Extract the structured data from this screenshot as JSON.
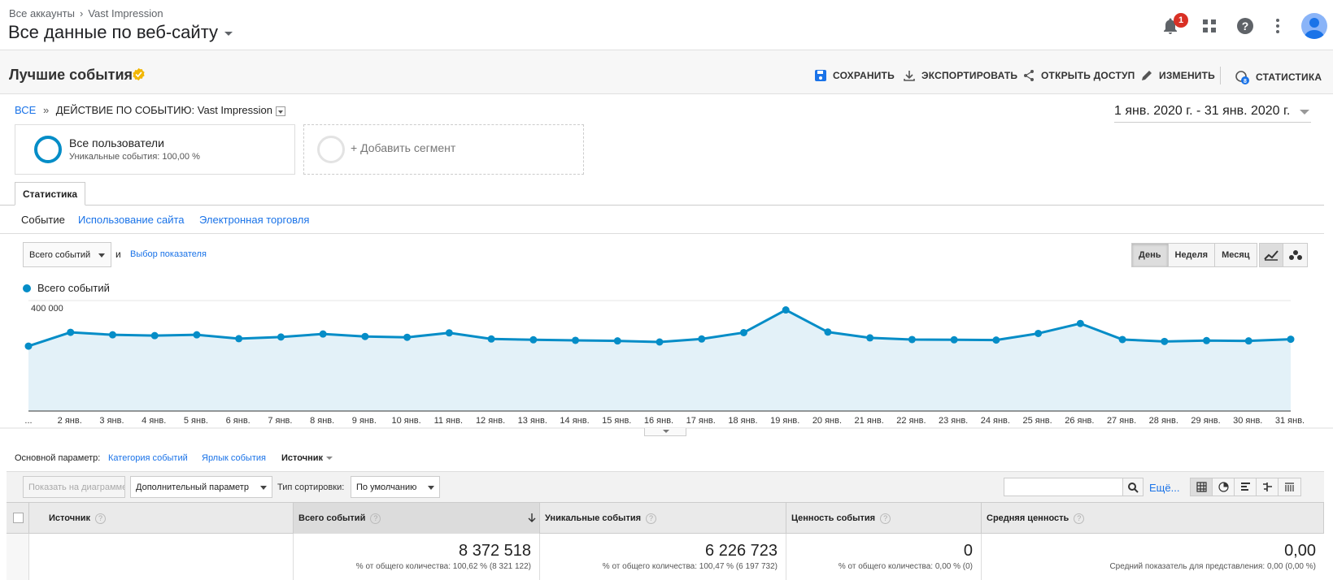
{
  "header": {
    "breadcrumb_root": "Все аккаунты",
    "breadcrumb_account": "Vast Impression",
    "view_title": "Все данные по веб-сайту",
    "notification_count": "1"
  },
  "report": {
    "title": "Лучшие события",
    "actions": {
      "save": "СОХРАНИТЬ",
      "export": "ЭКСПОРТИРОВАТЬ",
      "share": "ОТКРЫТЬ ДОСТУП",
      "edit": "ИЗМЕНИТЬ",
      "insights": "СТАТИСТИКА"
    },
    "insights_badge": "8",
    "breadcrumb_all": "ВСЕ",
    "breadcrumb_sep": "»",
    "breadcrumb_current": "ДЕЙСТВИЕ ПО СОБЫТИЮ: Vast Impression",
    "date_range": "1 янв. 2020 г. - 31 янв. 2020 г."
  },
  "segments": {
    "active_name": "Все пользователи",
    "active_sub": "Уникальные события: 100,00 %",
    "add_label": "+ Добавить сегмент"
  },
  "tabs": {
    "main": "Статистика",
    "sub": [
      "Событие",
      "Использование сайта",
      "Электронная торговля"
    ]
  },
  "chart_controls": {
    "metric": "Всего событий",
    "and": "и",
    "metric_pick": "Выбор показателя",
    "periods": [
      "День",
      "Неделя",
      "Месяц"
    ],
    "active_period": "День"
  },
  "chart_data": {
    "type": "area",
    "series": [
      {
        "name": "Всего событий",
        "values": [
          235000,
          285000,
          276000,
          273000,
          276000,
          262000,
          268000,
          279000,
          270000,
          267000,
          283000,
          261000,
          258000,
          256000,
          254000,
          250000,
          261000,
          284000,
          366000,
          286000,
          265000,
          259000,
          258000,
          257000,
          281000,
          317000,
          259000,
          252000,
          255000,
          254000,
          260000
        ]
      }
    ],
    "x": [
      "...",
      "2 янв.",
      "3 янв.",
      "4 янв.",
      "5 янв.",
      "6 янв.",
      "7 янв.",
      "8 янв.",
      "9 янв.",
      "10 янв.",
      "11 янв.",
      "12 янв.",
      "13 янв.",
      "14 янв.",
      "15 янв.",
      "16 янв.",
      "17 янв.",
      "18 янв.",
      "19 янв.",
      "20 янв.",
      "21 янв.",
      "22 янв.",
      "23 янв.",
      "24 янв.",
      "25 янв.",
      "26 янв.",
      "27 янв.",
      "28 янв.",
      "29 янв.",
      "30 янв.",
      "31 янв."
    ],
    "y_ticks": [
      "400 000",
      "200 000"
    ],
    "y_tick_values": [
      400000,
      200000
    ],
    "ylim": [
      0,
      400000
    ],
    "color": "#058dc7",
    "fill": "#e3f1f8",
    "grid": true,
    "legend": "top-left"
  },
  "primary_dimension": {
    "label": "Основной параметр:",
    "options": [
      "Категория событий",
      "Ярлык события",
      "Источник"
    ],
    "active": "Источник"
  },
  "toolbar": {
    "plot_rows": "Показать на диаграмме",
    "secondary_dim": "Дополнительный параметр",
    "sort_label": "Тип сортировки:",
    "sort_value": "По умолчанию",
    "search_placeholder": "",
    "more": "Ещё..."
  },
  "table": {
    "headers": [
      "Источник",
      "Всего событий",
      "Уникальные события",
      "Ценность события",
      "Средняя ценность"
    ],
    "help": "?",
    "totals": [
      {
        "value": "8 372 518",
        "sub": "% от общего количества: 100,62 % (8 321 122)"
      },
      {
        "value": "6 226 723",
        "sub": "% от общего количества: 100,47 % (6 197 732)"
      },
      {
        "value": "0",
        "sub": "% от общего количества: 0,00 % (0)"
      },
      {
        "value": "0,00",
        "sub": "Средний показатель для представления: 0,00 (0,00 %)"
      }
    ]
  }
}
